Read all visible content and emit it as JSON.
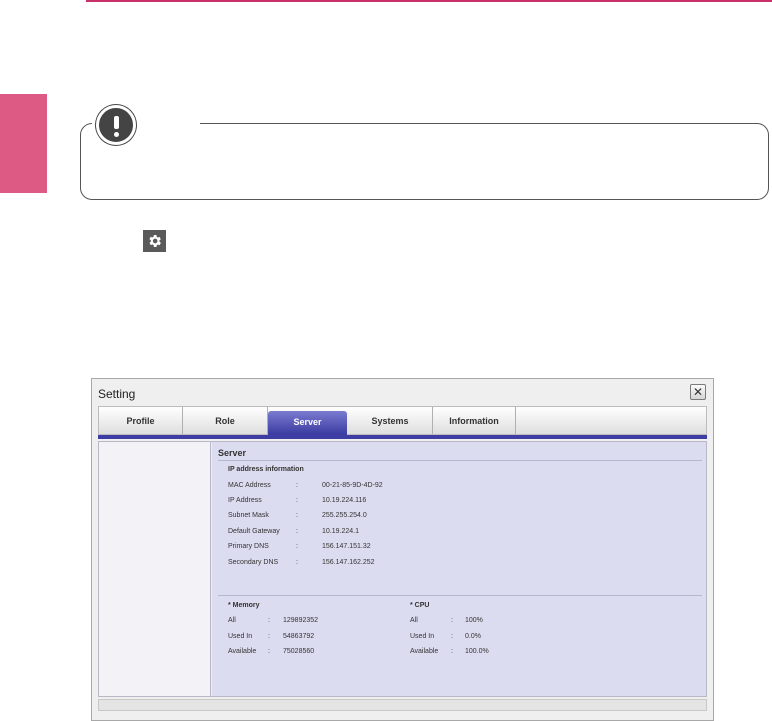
{
  "colors": {
    "accent": "#c8306a",
    "side_tab": "#dd5a85",
    "active_tab": "#3a3aa0",
    "content_bg": "#dcdcf0"
  },
  "note": {
    "icon": "exclamation-icon"
  },
  "settings_icon": "gear-icon",
  "window": {
    "title": "Setting",
    "close_label": "✕",
    "tabs": [
      {
        "label": "Profile",
        "active": false
      },
      {
        "label": "Role",
        "active": false
      },
      {
        "label": "Server",
        "active": true
      },
      {
        "label": "Systems",
        "active": false
      },
      {
        "label": "Information",
        "active": false
      }
    ],
    "server": {
      "title": "Server",
      "ip_section_title": "IP address information",
      "ip_fields": [
        {
          "label": "MAC Address",
          "value": "00-21-85-9D-4D-92"
        },
        {
          "label": "IP Address",
          "value": "10.19.224.116"
        },
        {
          "label": "Subnet Mask",
          "value": "255.255.254.0"
        },
        {
          "label": "Default Gateway",
          "value": "10.19.224.1"
        },
        {
          "label": "Primary DNS",
          "value": "156.147.151.32"
        },
        {
          "label": "Secondary DNS",
          "value": "156.147.162.252"
        }
      ],
      "memory": {
        "title": "* Memory",
        "rows": [
          {
            "label": "All",
            "value": "129892352"
          },
          {
            "label": "Used In",
            "value": "54863792"
          },
          {
            "label": "Available",
            "value": "75028560"
          }
        ]
      },
      "cpu": {
        "title": "* CPU",
        "rows": [
          {
            "label": "All",
            "value": "100%"
          },
          {
            "label": "Used In",
            "value": "0.0%"
          },
          {
            "label": "Available",
            "value": "100.0%"
          }
        ]
      },
      "separator": ":"
    }
  }
}
